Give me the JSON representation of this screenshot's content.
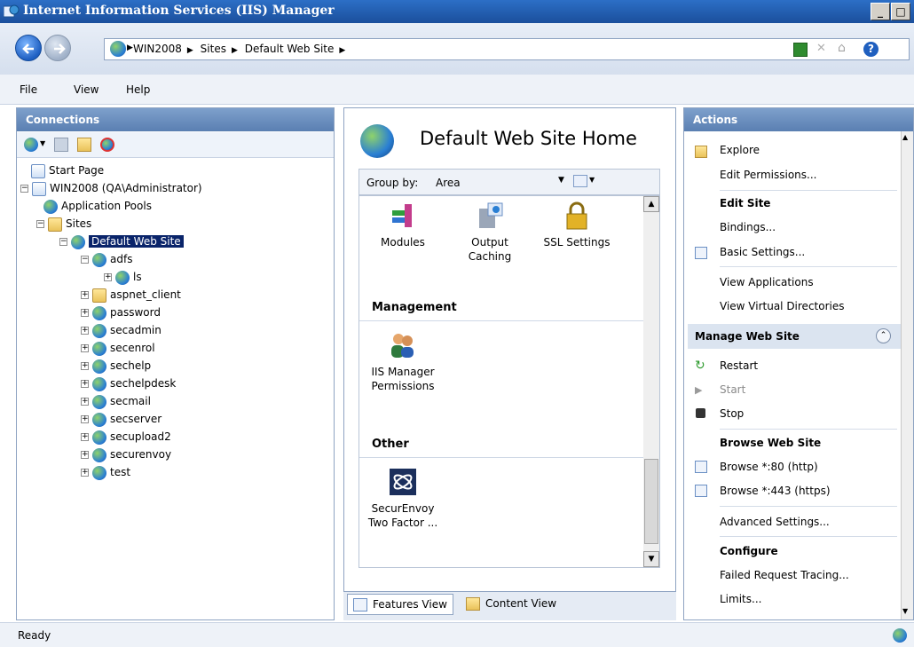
{
  "window": {
    "title": "Internet Information Services (IIS) Manager"
  },
  "address": {
    "crumbs": [
      "WIN2008",
      "Sites",
      "Default Web Site"
    ]
  },
  "menu": [
    "File",
    "View",
    "Help"
  ],
  "connections": {
    "title": "Connections",
    "tree": [
      {
        "label": "Start Page",
        "icon": "start-page-icon"
      },
      {
        "label": "WIN2008 (QA\\Administrator)",
        "icon": "server-icon"
      },
      {
        "label": "Application Pools",
        "icon": "app-pools-icon"
      },
      {
        "label": "Sites",
        "icon": "sites-folder-icon"
      },
      {
        "label": "Default Web Site",
        "icon": "globe-icon",
        "selected": true
      },
      {
        "label": "adfs",
        "icon": "web-app-icon"
      },
      {
        "label": "ls",
        "icon": "web-app-icon"
      },
      {
        "label": "aspnet_client",
        "icon": "folder-icon"
      },
      {
        "label": "password",
        "icon": "web-app-icon"
      },
      {
        "label": "secadmin",
        "icon": "web-app-icon"
      },
      {
        "label": "secenrol",
        "icon": "web-app-icon"
      },
      {
        "label": "sechelp",
        "icon": "web-app-icon"
      },
      {
        "label": "sechelpdesk",
        "icon": "web-app-icon"
      },
      {
        "label": "secmail",
        "icon": "web-app-icon"
      },
      {
        "label": "secserver",
        "icon": "web-app-icon"
      },
      {
        "label": "secupload2",
        "icon": "web-app-icon"
      },
      {
        "label": "securenvoy",
        "icon": "web-app-icon"
      },
      {
        "label": "test",
        "icon": "web-app-icon"
      }
    ]
  },
  "center": {
    "title": "Default Web Site Home",
    "group_by_label": "Group by:",
    "group_by_value": "Area",
    "features": [
      "Modules",
      "Output Caching",
      "SSL Settings"
    ],
    "groups": [
      {
        "name": "Management",
        "items": [
          "IIS Manager Permissions"
        ]
      },
      {
        "name": "Other",
        "items": [
          "SecurEnvoy Two Factor ..."
        ]
      }
    ],
    "tabs": {
      "features_view": "Features View",
      "content_view": "Content View"
    }
  },
  "actions": {
    "title": "Actions",
    "explore": "Explore",
    "edit_permissions": "Edit Permissions...",
    "edit_site": "Edit Site",
    "bindings": "Bindings...",
    "basic_settings": "Basic Settings...",
    "view_applications": "View Applications",
    "view_virtual_dirs": "View Virtual Directories",
    "manage_web_site": "Manage Web Site",
    "restart": "Restart",
    "start": "Start",
    "stop": "Stop",
    "browse_web_site": "Browse Web Site",
    "browse_80": "Browse *:80 (http)",
    "browse_443": "Browse *:443 (https)",
    "advanced_settings": "Advanced Settings...",
    "configure": "Configure",
    "failed_request_tracing": "Failed Request Tracing...",
    "limits": "Limits..."
  },
  "status": {
    "text": "Ready"
  },
  "colors": {
    "titlebar": "#1b4f9c",
    "selection": "#0a246a",
    "panel_header": "#5a7fb2"
  }
}
